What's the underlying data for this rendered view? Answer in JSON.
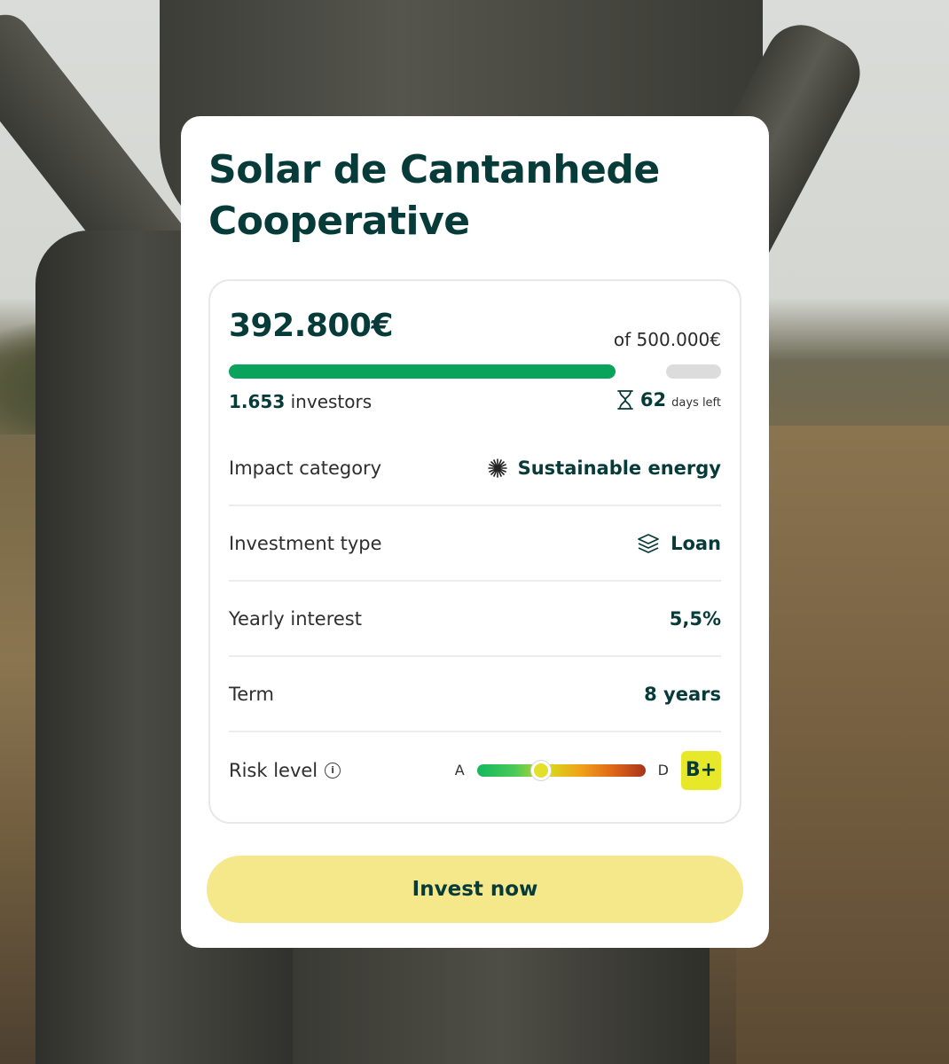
{
  "project": {
    "title": "Solar de Cantanhede Cooperative"
  },
  "funding": {
    "raised": "392.800€",
    "target": "of 500.000€",
    "progress_fraction": 0.7856,
    "investors_count": "1.653",
    "investors_label": "investors",
    "days_left": "62",
    "days_left_label": "days left"
  },
  "details": [
    {
      "label": "Impact category",
      "value": "Sustainable energy",
      "icon": "sun-burst-icon"
    },
    {
      "label": "Investment type",
      "value": "Loan",
      "icon": "layers-icon"
    },
    {
      "label": "Yearly interest",
      "value": "5,5%"
    },
    {
      "label": "Term",
      "value": "8 years"
    }
  ],
  "risk": {
    "label": "Risk level",
    "scale_start": "A",
    "scale_end": "D",
    "grade": "B+",
    "position_fraction": 0.38
  },
  "cta": {
    "label": "Invest now"
  },
  "colors": {
    "brand_dark": "#073b3a",
    "progress_green": "#0aa35b",
    "cta_yellow": "#f5e88a",
    "grade_yellow": "#e8e82a"
  }
}
